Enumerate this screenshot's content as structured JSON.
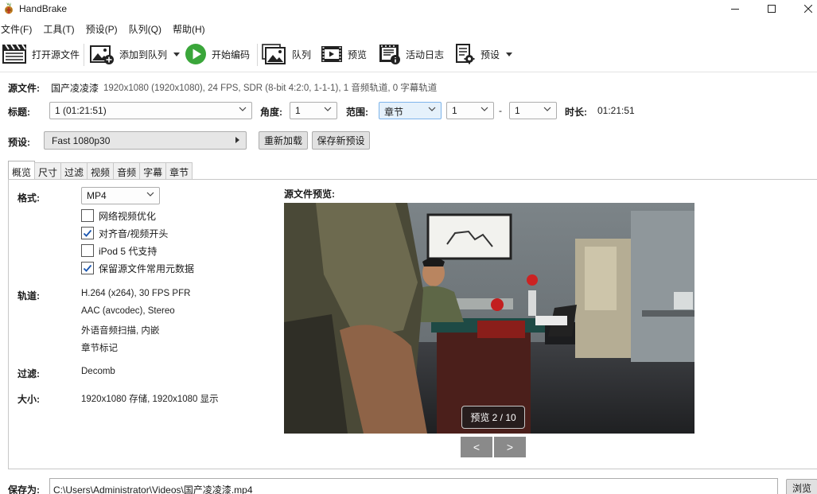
{
  "window": {
    "title": "HandBrake",
    "icon": "handbrake-pineapple-icon",
    "controls": [
      "minimize-icon",
      "maximize-icon",
      "close-icon"
    ]
  },
  "menu": [
    "文件(F)",
    "工具(T)",
    "预设(P)",
    "队列(Q)",
    "帮助(H)"
  ],
  "toolbar": {
    "open_source": "打开源文件",
    "add_to_queue": "添加到队列",
    "start_encode": "开始编码",
    "queue": "队列",
    "preview": "预览",
    "activity_log": "活动日志",
    "presets": "预设"
  },
  "source": {
    "label": "源文件:",
    "name": "国产凌凌漆",
    "info": "1920x1080 (1920x1080), 24 FPS, SDR (8-bit 4:2:0, 1-1-1), 1 音频轨道, 0 字幕轨道"
  },
  "title_row": {
    "title_label": "标题:",
    "title_value": "1  (01:21:51)",
    "angle_label": "角度:",
    "angle_value": "1",
    "range_label": "范围:",
    "range_type": "章节",
    "range_start": "1",
    "range_dash": "-",
    "range_end": "1",
    "duration_label": "时长:",
    "duration_value": "01:21:51"
  },
  "preset_row": {
    "label": "预设:",
    "value": "Fast 1080p30",
    "reload": "重新加载",
    "save_new": "保存新预设"
  },
  "tabs": [
    "概览",
    "尺寸",
    "过滤",
    "视频",
    "音频",
    "字幕",
    "章节"
  ],
  "active_tab": 0,
  "summary": {
    "format_label": "格式:",
    "format_value": "MP4",
    "options": [
      {
        "label": "网络视频优化",
        "checked": false
      },
      {
        "label": "对齐音/视频开头",
        "checked": true
      },
      {
        "label": "iPod 5 代支持",
        "checked": false
      },
      {
        "label": "保留源文件常用元数据",
        "checked": true
      }
    ],
    "tracks_label": "轨道:",
    "tracks": [
      "H.264 (x264), 30 FPS PFR",
      "AAC (avcodec), Stereo",
      "外语音频扫描, 内嵌",
      "章节标记"
    ],
    "filters_label": "过滤:",
    "filters_value": "Decomb",
    "size_label": "大小:",
    "size_value": "1920x1080 存储, 1920x1080 显示"
  },
  "preview": {
    "heading": "源文件预览:",
    "badge": "预览 2 / 10",
    "prev": "<",
    "next": ">"
  },
  "save": {
    "label": "保存为:",
    "path": "C:\\Users\\Administrator\\Videos\\国产凌凌漆.mp4",
    "browse": "浏览"
  },
  "colors": {
    "accent": "#0078d7",
    "start_green": "#3aa63a",
    "highlight_combo": "#e5f1fb"
  }
}
